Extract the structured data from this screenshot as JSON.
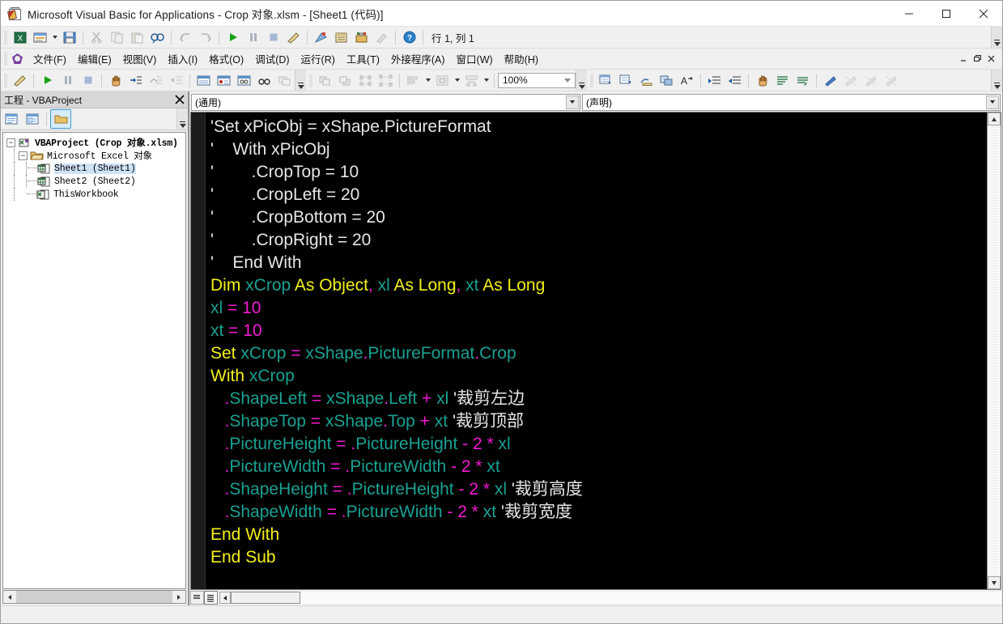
{
  "window": {
    "title": "Microsoft Visual Basic for Applications - Crop 对象.xlsm - [Sheet1 (代码)]",
    "minimize_label": "—",
    "maximize_label": "□",
    "close_label": "✕",
    "mdi_minimize_label": "–",
    "mdi_restore_label": "❐",
    "mdi_close_label": "✕"
  },
  "menu": {
    "items": [
      {
        "label": "文件(F)"
      },
      {
        "label": "编辑(E)"
      },
      {
        "label": "视图(V)"
      },
      {
        "label": "插入(I)"
      },
      {
        "label": "格式(O)"
      },
      {
        "label": "调试(D)"
      },
      {
        "label": "运行(R)"
      },
      {
        "label": "工具(T)"
      },
      {
        "label": "外接程序(A)"
      },
      {
        "label": "窗口(W)"
      },
      {
        "label": "帮助(H)"
      }
    ]
  },
  "toolbar_standard": {
    "position_label": "行 1, 列 1",
    "buttons": [
      {
        "name": "view-excel-icon"
      },
      {
        "name": "insert-object-icon"
      },
      {
        "name": "save-icon"
      },
      {
        "name": "cut-icon"
      },
      {
        "name": "copy-icon"
      },
      {
        "name": "paste-icon"
      },
      {
        "name": "find-icon"
      },
      {
        "name": "undo-icon"
      },
      {
        "name": "redo-icon"
      },
      {
        "name": "run-icon"
      },
      {
        "name": "pause-icon"
      },
      {
        "name": "stop-icon"
      },
      {
        "name": "design-mode-icon"
      },
      {
        "name": "project-explorer-icon"
      },
      {
        "name": "properties-window-icon"
      },
      {
        "name": "object-browser-icon"
      },
      {
        "name": "toolbox-icon"
      },
      {
        "name": "help-icon"
      }
    ]
  },
  "toolbar_edit": {
    "zoom_value": "100%",
    "buttons": [
      {
        "name": "design-mode-icon"
      },
      {
        "name": "run-icon"
      },
      {
        "name": "pause-icon"
      },
      {
        "name": "stop-icon"
      },
      {
        "name": "hand-icon"
      },
      {
        "name": "step-into-icon"
      },
      {
        "name": "step-over-icon"
      },
      {
        "name": "step-out-icon"
      },
      {
        "name": "window-icon"
      },
      {
        "name": "breakpoint-icon"
      },
      {
        "name": "watch-window-icon"
      },
      {
        "name": "binoculars-icon"
      },
      {
        "name": "call-stack-icon"
      },
      {
        "name": "bring-front-icon"
      },
      {
        "name": "send-back-icon"
      },
      {
        "name": "group-icon"
      },
      {
        "name": "ungroup-icon"
      },
      {
        "name": "align-icon"
      },
      {
        "name": "center-icon"
      },
      {
        "name": "spacing-icon"
      },
      {
        "name": "list-properties-icon"
      },
      {
        "name": "list-constants-icon"
      },
      {
        "name": "quick-info-icon"
      },
      {
        "name": "parameter-info-icon"
      },
      {
        "name": "complete-word-icon"
      },
      {
        "name": "indent-icon"
      },
      {
        "name": "outdent-icon"
      },
      {
        "name": "hand-icon"
      },
      {
        "name": "comment-block-icon"
      },
      {
        "name": "uncomment-block-icon"
      },
      {
        "name": "bookmark-toggle-icon"
      },
      {
        "name": "bookmark-next-icon"
      },
      {
        "name": "bookmark-prev-icon"
      },
      {
        "name": "bookmark-clear-icon"
      }
    ]
  },
  "project_explorer": {
    "title": "工程 - VBAProject",
    "close_label": "✕",
    "tools": [
      {
        "name": "view-code-icon"
      },
      {
        "name": "view-object-icon"
      },
      {
        "name": "toggle-folders-icon"
      }
    ],
    "tree": [
      {
        "label": "VBAProject (Crop 对象.xlsm)",
        "level": 0,
        "icon": "project-icon",
        "expanded": true
      },
      {
        "label": "Microsoft Excel 对象",
        "level": 1,
        "icon": "folder-icon",
        "expanded": true
      },
      {
        "label": "Sheet1 (Sheet1)",
        "level": 2,
        "icon": "sheet-icon",
        "selected": true
      },
      {
        "label": "Sheet2 (Sheet2)",
        "level": 2,
        "icon": "sheet-icon"
      },
      {
        "label": "ThisWorkbook",
        "level": 2,
        "icon": "workbook-icon"
      }
    ]
  },
  "code_window": {
    "object_combo": "(通用)",
    "procedure_combo": "(声明)",
    "footer_buttons": [
      {
        "name": "procedure-view-button"
      },
      {
        "name": "full-module-view-button"
      }
    ],
    "colors": {
      "background": "#000000",
      "comment": "#e6e6e6",
      "keyword": "#f4f018",
      "identifier": "#19a193",
      "operator": "#f21ad2"
    },
    "lines": [
      [
        {
          "t": "'Set xPicObj = xShape.PictureFormat",
          "c": "cmt"
        }
      ],
      [
        {
          "t": "'    With xPicObj",
          "c": "cmt"
        }
      ],
      [
        {
          "t": "'        .CropTop = 10",
          "c": "cmt"
        }
      ],
      [
        {
          "t": "'        .CropLeft = 20",
          "c": "cmt"
        }
      ],
      [
        {
          "t": "'        .CropBottom = 20",
          "c": "cmt"
        }
      ],
      [
        {
          "t": "'        .CropRight = 20",
          "c": "cmt"
        }
      ],
      [
        {
          "t": "'    End With",
          "c": "cmt"
        }
      ],
      [
        {
          "t": "Dim ",
          "c": "kw"
        },
        {
          "t": "xCrop ",
          "c": "id"
        },
        {
          "t": "As Object",
          "c": "kw"
        },
        {
          "t": ", ",
          "c": "op"
        },
        {
          "t": "xl ",
          "c": "id"
        },
        {
          "t": "As Long",
          "c": "kw"
        },
        {
          "t": ", ",
          "c": "op"
        },
        {
          "t": "xt ",
          "c": "id"
        },
        {
          "t": "As Long",
          "c": "kw"
        }
      ],
      [
        {
          "t": "xl ",
          "c": "id"
        },
        {
          "t": "= ",
          "c": "op"
        },
        {
          "t": "10",
          "c": "num"
        }
      ],
      [
        {
          "t": "xt ",
          "c": "id"
        },
        {
          "t": "= ",
          "c": "op"
        },
        {
          "t": "10",
          "c": "num"
        }
      ],
      [
        {
          "t": "Set ",
          "c": "kw"
        },
        {
          "t": "xCrop ",
          "c": "id"
        },
        {
          "t": "= ",
          "c": "op"
        },
        {
          "t": "xShape",
          "c": "id"
        },
        {
          "t": ".",
          "c": "op"
        },
        {
          "t": "PictureFormat",
          "c": "id"
        },
        {
          "t": ".",
          "c": "op"
        },
        {
          "t": "Crop",
          "c": "id"
        }
      ],
      [
        {
          "t": "With ",
          "c": "kw"
        },
        {
          "t": "xCrop",
          "c": "id"
        }
      ],
      [
        {
          "t": "   ",
          "c": "id"
        },
        {
          "t": ".",
          "c": "op"
        },
        {
          "t": "ShapeLeft ",
          "c": "id"
        },
        {
          "t": "= ",
          "c": "op"
        },
        {
          "t": "xShape",
          "c": "id"
        },
        {
          "t": ".",
          "c": "op"
        },
        {
          "t": "Left ",
          "c": "id"
        },
        {
          "t": "+ ",
          "c": "op"
        },
        {
          "t": "xl ",
          "c": "id"
        },
        {
          "t": "'裁剪左边",
          "c": "cmt"
        }
      ],
      [
        {
          "t": "   ",
          "c": "id"
        },
        {
          "t": ".",
          "c": "op"
        },
        {
          "t": "ShapeTop ",
          "c": "id"
        },
        {
          "t": "= ",
          "c": "op"
        },
        {
          "t": "xShape",
          "c": "id"
        },
        {
          "t": ".",
          "c": "op"
        },
        {
          "t": "Top ",
          "c": "id"
        },
        {
          "t": "+ ",
          "c": "op"
        },
        {
          "t": "xt ",
          "c": "id"
        },
        {
          "t": "'裁剪顶部",
          "c": "cmt"
        }
      ],
      [
        {
          "t": "   ",
          "c": "id"
        },
        {
          "t": ".",
          "c": "op"
        },
        {
          "t": "PictureHeight ",
          "c": "id"
        },
        {
          "t": "= ",
          "c": "op"
        },
        {
          "t": ".",
          "c": "op"
        },
        {
          "t": "PictureHeight ",
          "c": "id"
        },
        {
          "t": "- ",
          "c": "op"
        },
        {
          "t": "2 ",
          "c": "num"
        },
        {
          "t": "* ",
          "c": "op"
        },
        {
          "t": "xl",
          "c": "id"
        }
      ],
      [
        {
          "t": "   ",
          "c": "id"
        },
        {
          "t": ".",
          "c": "op"
        },
        {
          "t": "PictureWidth ",
          "c": "id"
        },
        {
          "t": "= ",
          "c": "op"
        },
        {
          "t": ".",
          "c": "op"
        },
        {
          "t": "PictureWidth ",
          "c": "id"
        },
        {
          "t": "- ",
          "c": "op"
        },
        {
          "t": "2 ",
          "c": "num"
        },
        {
          "t": "* ",
          "c": "op"
        },
        {
          "t": "xt",
          "c": "id"
        }
      ],
      [
        {
          "t": "   ",
          "c": "id"
        },
        {
          "t": ".",
          "c": "op"
        },
        {
          "t": "ShapeHeight ",
          "c": "id"
        },
        {
          "t": "= ",
          "c": "op"
        },
        {
          "t": ".",
          "c": "op"
        },
        {
          "t": "PictureHeight ",
          "c": "id"
        },
        {
          "t": "- ",
          "c": "op"
        },
        {
          "t": "2 ",
          "c": "num"
        },
        {
          "t": "* ",
          "c": "op"
        },
        {
          "t": "xl ",
          "c": "id"
        },
        {
          "t": "'裁剪高度",
          "c": "cmt"
        }
      ],
      [
        {
          "t": "   ",
          "c": "id"
        },
        {
          "t": ".",
          "c": "op"
        },
        {
          "t": "ShapeWidth ",
          "c": "id"
        },
        {
          "t": "= ",
          "c": "op"
        },
        {
          "t": ".",
          "c": "op"
        },
        {
          "t": "PictureWidth ",
          "c": "id"
        },
        {
          "t": "- ",
          "c": "op"
        },
        {
          "t": "2 ",
          "c": "num"
        },
        {
          "t": "* ",
          "c": "op"
        },
        {
          "t": "xt ",
          "c": "id"
        },
        {
          "t": "'裁剪宽度",
          "c": "cmt"
        }
      ],
      [
        {
          "t": "End With",
          "c": "kw"
        }
      ],
      [
        {
          "t": "End Sub",
          "c": "kw"
        }
      ]
    ]
  }
}
